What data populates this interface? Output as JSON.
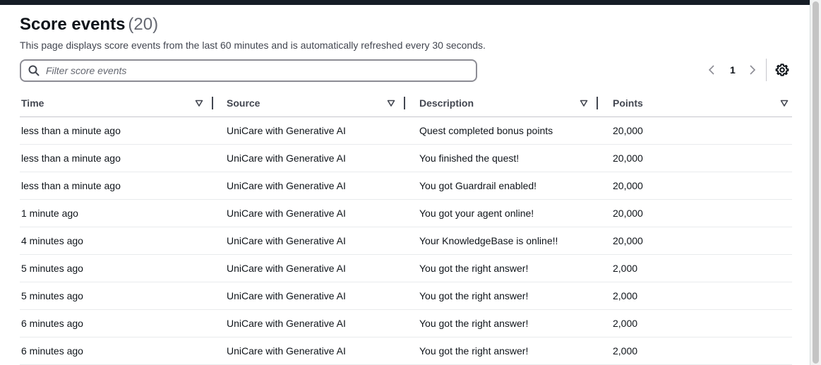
{
  "header": {
    "title": "Score events",
    "count": "(20)",
    "description": "This page displays score events from the last 60 minutes and is automatically refreshed every 30 seconds."
  },
  "filter": {
    "placeholder": "Filter score events",
    "value": ""
  },
  "pagination": {
    "current_page": "1"
  },
  "table": {
    "columns": [
      "Time",
      "Source",
      "Description",
      "Points"
    ],
    "rows": [
      [
        "less than a minute ago",
        "UniCare with Generative AI",
        "Quest completed bonus points",
        "20,000"
      ],
      [
        "less than a minute ago",
        "UniCare with Generative AI",
        "You finished the quest!",
        "20,000"
      ],
      [
        "less than a minute ago",
        "UniCare with Generative AI",
        "You got Guardrail enabled!",
        "20,000"
      ],
      [
        "1 minute ago",
        "UniCare with Generative AI",
        "You got your agent online!",
        "20,000"
      ],
      [
        "4 minutes ago",
        "UniCare with Generative AI",
        "Your KnowledgeBase is online!!",
        "20,000"
      ],
      [
        "5 minutes ago",
        "UniCare with Generative AI",
        "You got the right answer!",
        "2,000"
      ],
      [
        "5 minutes ago",
        "UniCare with Generative AI",
        "You got the right answer!",
        "2,000"
      ],
      [
        "6 minutes ago",
        "UniCare with Generative AI",
        "You got the right answer!",
        "2,000"
      ],
      [
        "6 minutes ago",
        "UniCare with Generative AI",
        "You got the right answer!",
        "2,000"
      ]
    ]
  },
  "icons": {
    "search": "search-icon",
    "prev": "chevron-left-icon",
    "next": "chevron-right-icon",
    "settings": "gear-icon",
    "sort": "caret-down-icon"
  },
  "colors": {
    "top_bar": "#161d26",
    "text": "#0f141a",
    "muted_text": "#656871",
    "border": "#8c8c94"
  }
}
